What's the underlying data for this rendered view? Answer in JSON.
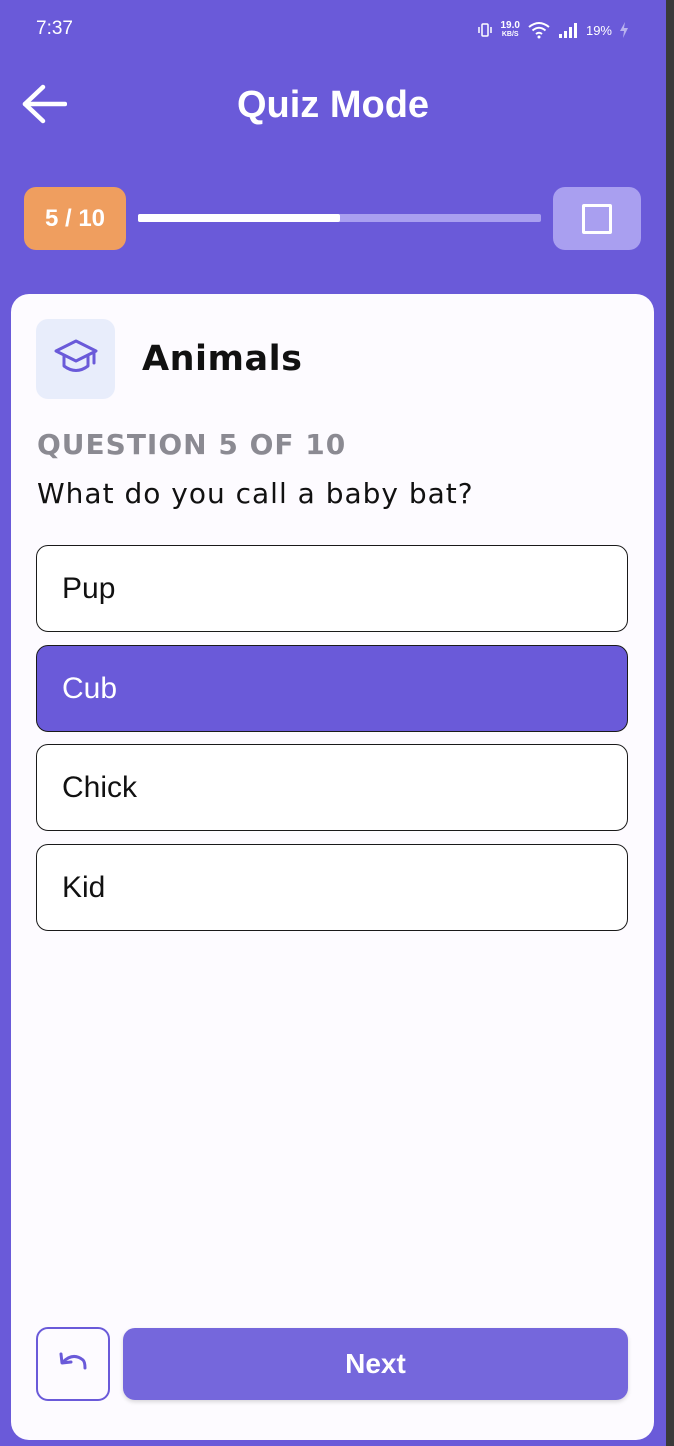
{
  "status_bar": {
    "time": "7:37",
    "speed_value": "19.0",
    "speed_unit": "KB/S",
    "battery": "19%"
  },
  "header": {
    "title": "Quiz Mode",
    "back_icon": "arrow-left-icon"
  },
  "progress": {
    "label": "5 / 10",
    "fraction": 0.5,
    "stop_icon": "stop-square-icon"
  },
  "card": {
    "category_icon": "graduation-cap-icon",
    "category": "Animals",
    "counter": "QUESTION 5 OF 10",
    "question": "What do you call a baby bat?",
    "options": [
      {
        "label": "Pup",
        "selected": false
      },
      {
        "label": "Cub",
        "selected": true
      },
      {
        "label": "Chick",
        "selected": false
      },
      {
        "label": "Kid",
        "selected": false
      }
    ],
    "undo_icon": "undo-icon",
    "next_label": "Next"
  },
  "colors": {
    "primary": "#6a5ad9",
    "badge": "#ef9e5f",
    "track": "#a99ff0",
    "card": "#fdfbff"
  }
}
